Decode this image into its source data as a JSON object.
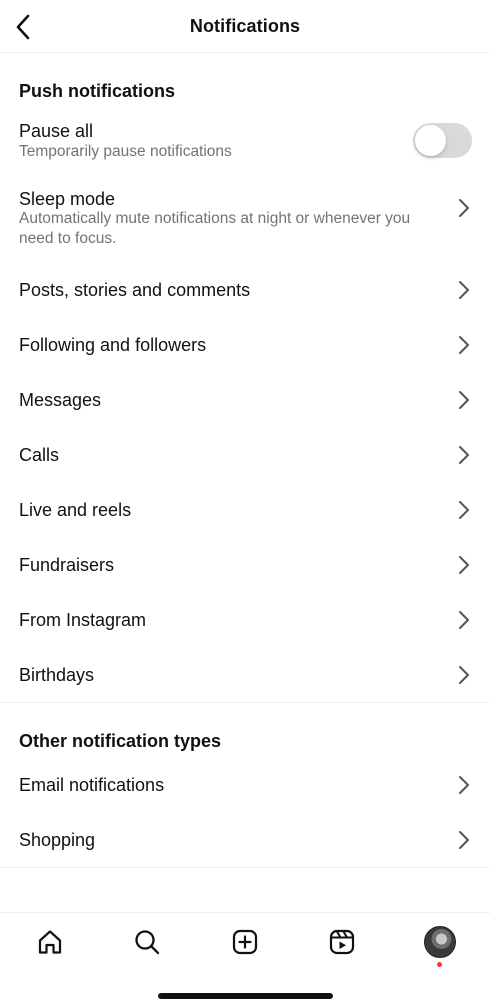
{
  "header": {
    "title": "Notifications"
  },
  "push_section": {
    "title": "Push notifications",
    "pause_all": {
      "label": "Pause all",
      "subtitle": "Temporarily pause notifications",
      "enabled": false
    },
    "sleep_mode": {
      "label": "Sleep mode",
      "subtitle": "Automatically mute notifications at night or whenever you need to focus."
    },
    "items": [
      "Posts, stories and comments",
      "Following and followers",
      "Messages",
      "Calls",
      "Live and reels",
      "Fundraisers",
      "From Instagram",
      "Birthdays"
    ]
  },
  "other_section": {
    "title": "Other notification types",
    "items": [
      "Email notifications",
      "Shopping"
    ]
  },
  "tabbar": {
    "icons": [
      "home-icon",
      "search-icon",
      "create-icon",
      "reels-icon",
      "profile-avatar"
    ],
    "notification_dot_color": "#ff3040"
  },
  "colors": {
    "text": "#111111",
    "secondary": "#737373",
    "toggle_off": "#d9d9dc"
  }
}
